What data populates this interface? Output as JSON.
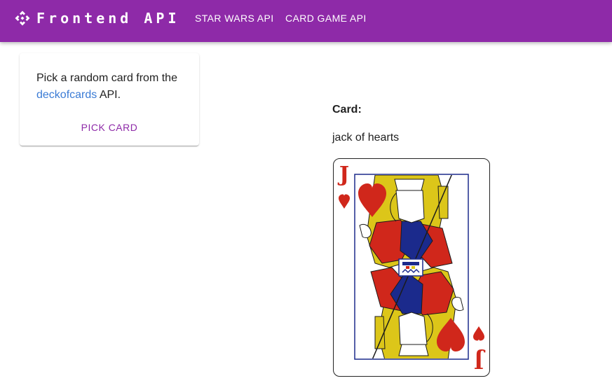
{
  "header": {
    "title": "Frontend API",
    "nav": [
      {
        "label": "STAR WARS API"
      },
      {
        "label": "CARD GAME API"
      }
    ]
  },
  "picker": {
    "text_prefix": "Pick a random card from the ",
    "link_text": "deckofcards",
    "text_suffix": " API.",
    "button_label": "PICK CARD"
  },
  "result": {
    "label": "Card:",
    "card_name": "jack of hearts",
    "card_rank": "J",
    "card_suit": "hearts"
  },
  "colors": {
    "primary": "#8e2aa8",
    "link": "#3a7bd5",
    "card_red": "#d0271b",
    "card_blue": "#1b2a8c",
    "card_gold": "#dcc619"
  },
  "icons": {
    "brand": "diamond-arrows-icon"
  }
}
